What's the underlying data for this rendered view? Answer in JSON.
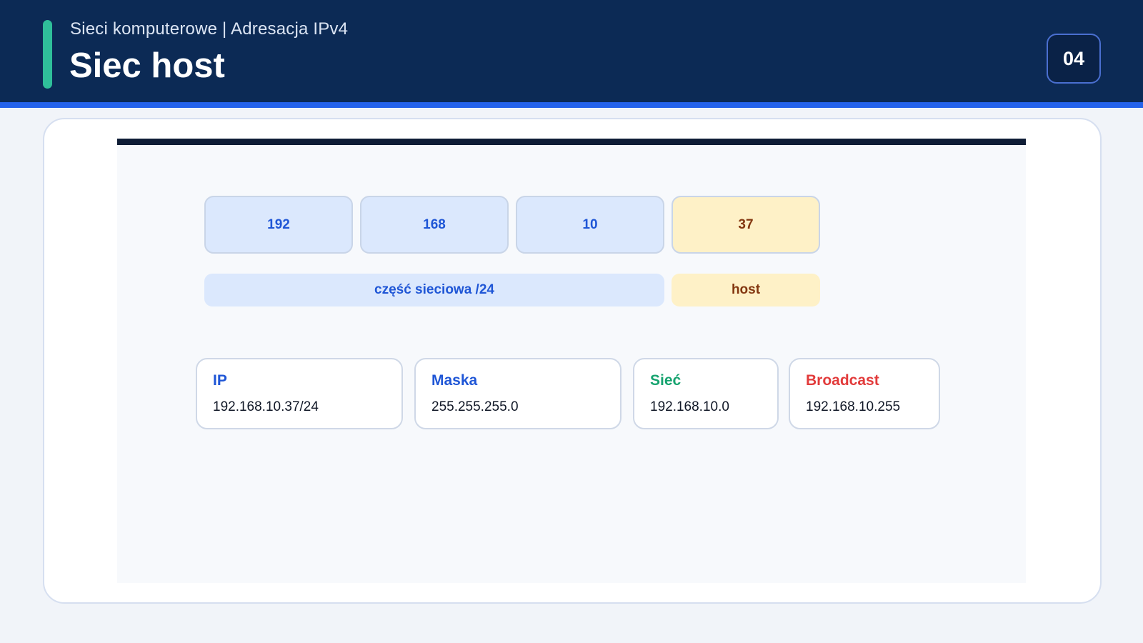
{
  "header": {
    "subtitle": "Sieci komputerowe | Adresacja IPv4",
    "title": "Siec host",
    "page_number": "04"
  },
  "diagram": {
    "octets": [
      {
        "value": "192",
        "part": "network"
      },
      {
        "value": "168",
        "part": "network"
      },
      {
        "value": "10",
        "part": "network"
      },
      {
        "value": "37",
        "part": "host"
      }
    ],
    "segments": {
      "network_label": "część sieciowa /24",
      "host_label": "host"
    },
    "info_cards": [
      {
        "label": "IP",
        "value": "192.168.10.37/24",
        "color": "#1f56d6"
      },
      {
        "label": "Maska",
        "value": "255.255.255.0",
        "color": "#1f56d6"
      },
      {
        "label": "Sieć",
        "value": "192.168.10.0",
        "color": "#16a36f"
      },
      {
        "label": "Broadcast",
        "value": "192.168.10.255",
        "color": "#e23b3b"
      }
    ]
  },
  "colors": {
    "header_bg": "#0c2a55",
    "accent": "#2fbf9a",
    "brand_blue": "#2563eb",
    "network_fill": "#dbe8fd",
    "host_fill": "#fef1c7"
  }
}
